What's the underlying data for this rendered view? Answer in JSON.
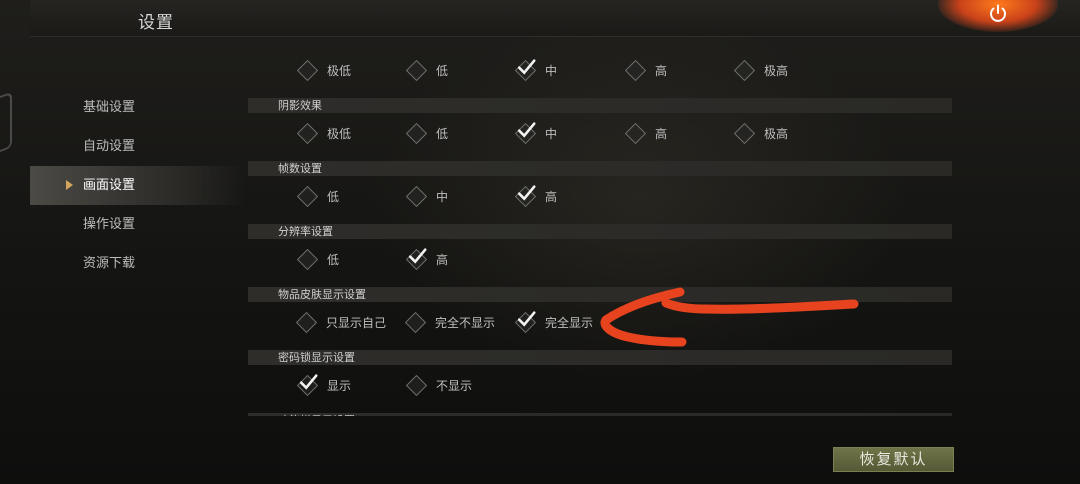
{
  "header": {
    "title": "设置",
    "power_icon": "power-icon"
  },
  "sidebar": {
    "items": [
      {
        "label": "基础设置",
        "active": false
      },
      {
        "label": "自动设置",
        "active": false
      },
      {
        "label": "画面设置",
        "active": true
      },
      {
        "label": "操作设置",
        "active": false
      },
      {
        "label": "资源下载",
        "active": false
      }
    ]
  },
  "sections": [
    {
      "title": "",
      "options": [
        "极低",
        "低",
        "中",
        "高",
        "极高"
      ],
      "selected": 2
    },
    {
      "title": "阴影效果",
      "options": [
        "极低",
        "低",
        "中",
        "高",
        "极高"
      ],
      "selected": 2
    },
    {
      "title": "帧数设置",
      "options": [
        "低",
        "中",
        "高"
      ],
      "selected": 2
    },
    {
      "title": "分辨率设置",
      "options": [
        "低",
        "高"
      ],
      "selected": 1
    },
    {
      "title": "物品皮肤显示设置",
      "options": [
        "只显示自己",
        "完全不显示",
        "完全显示"
      ],
      "selected": 2
    },
    {
      "title": "密码锁显示设置",
      "options": [
        "显示",
        "不显示"
      ],
      "selected": 0
    },
    {
      "title": "功能栏显示设置",
      "options": [],
      "selected": -1
    }
  ],
  "footer": {
    "restore_label": "恢复默认"
  },
  "colors": {
    "accent_arrow": "#e8431f",
    "active_marker": "#d2a45d",
    "restore_button": "#5f6440"
  },
  "annotation": {
    "arrow_icon": "hand-drawn-arrow-icon"
  }
}
